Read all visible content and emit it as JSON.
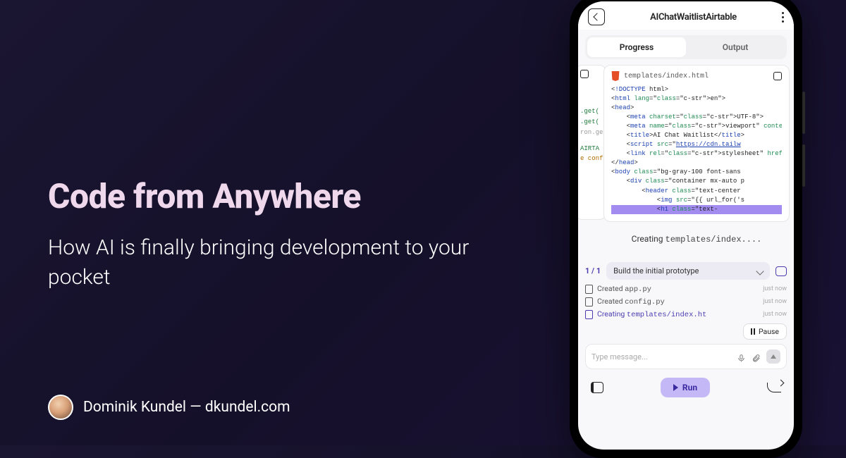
{
  "hero": {
    "headline": "Code from Anywhere",
    "subhead": "How AI is finally bringing development to your pocket"
  },
  "author": {
    "name": "Dominik Kundel",
    "site": "dkundel.com",
    "separator": " — "
  },
  "app": {
    "title": "AIChatWaitlistAirtable",
    "tabs": {
      "progress": "Progress",
      "output": "Output"
    },
    "activeFile": "templates/index.html",
    "codeLines": [
      "<!DOCTYPE html>",
      "<html lang=\"en\">",
      "<head>",
      "    <meta charset=\"UTF-8\">",
      "    <meta name=\"viewport\" content=\"",
      "    <title>AI Chat Waitlist</title>",
      "    <script src=\"https://cdn.tailw",
      "    <link rel=\"stylesheet\" href=\"{",
      "</head>",
      "<body class=\"bg-gray-100 font-sans",
      "    <div class=\"container mx-auto p",
      "        <header class=\"text-center",
      "            <img src=\"{{ url_for('s",
      "            <h1 class=\"text-"
    ],
    "statusPrefix": "Creating ",
    "statusFile": "templates/index....",
    "taskCount": "1 / 1",
    "taskLabel": "Build the initial prototype",
    "events": [
      {
        "verb": "Created ",
        "file": "app.py",
        "time": "just now",
        "active": false
      },
      {
        "verb": "Created ",
        "file": "config.py",
        "time": "just now",
        "active": false
      },
      {
        "verb": "Creating ",
        "file": "templates/index.ht",
        "time": "just now",
        "active": true
      }
    ],
    "pause": "Pause",
    "inputPlaceholder": "Type message...",
    "run": "Run",
    "bgFrag": {
      "l1": ".get(",
      "l2": ".get(",
      "l3": "ron.ge",
      "l4": "AIRTA",
      "l5": "e conf"
    }
  }
}
